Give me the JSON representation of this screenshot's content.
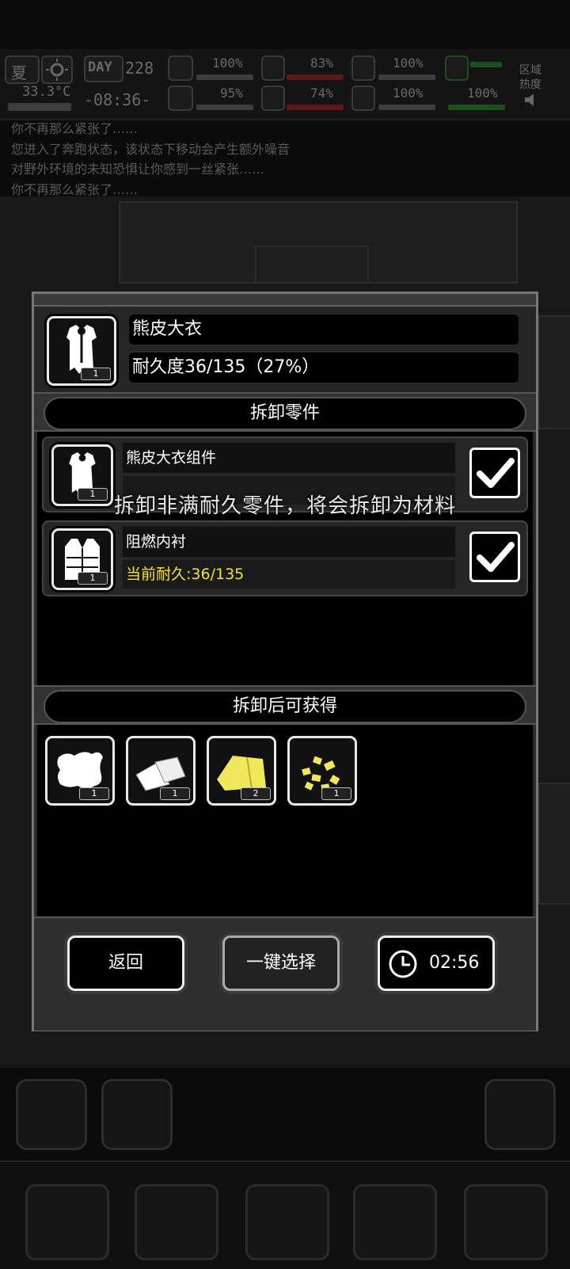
{
  "hud": {
    "season": "夏",
    "day_label": "DAY",
    "day_number": "228",
    "temperature": "33.3°C",
    "clock": "-08:36-",
    "stats": [
      {
        "icon": "medkit-icon",
        "value": "100%"
      },
      {
        "icon": "stomach-icon",
        "value": "83%"
      },
      {
        "icon": "lungs-icon",
        "value": "100%"
      },
      {
        "icon": "brain-icon",
        "value": "95%"
      },
      {
        "icon": "water-drop-icon",
        "value": "74%"
      },
      {
        "icon": "heart-icon",
        "value": "100%"
      },
      {
        "icon": "shield-icon",
        "value": "100%"
      }
    ],
    "zone_label_1": "区域",
    "zone_label_2": "热度"
  },
  "log_lines": [
    "你不再那么紧张了……",
    "您进入了奔跑状态，该状态下移动会产生额外噪音",
    "对野外环境的未知恐惧让你感到一丝紧张……",
    "你不再那么紧张了……"
  ],
  "modal": {
    "item": {
      "name": "熊皮大衣",
      "durability": "耐久度36/135（27%）",
      "quantity": "1",
      "icon": "bear-coat-icon"
    },
    "parts_header": "拆卸零件",
    "parts": [
      {
        "name": "熊皮大衣组件",
        "durability": "",
        "quantity": "1",
        "checked": true,
        "icon": "bear-coat-icon"
      },
      {
        "name": "阻燃内衬",
        "durability": "当前耐久:36/135",
        "quantity": "1",
        "checked": true,
        "icon": "vest-icon"
      }
    ],
    "results_header": "拆卸后可获得",
    "results": [
      {
        "icon": "fur-pelt-icon",
        "quantity": "1"
      },
      {
        "icon": "cloth-scraps-icon",
        "quantity": "1"
      },
      {
        "icon": "yellow-fabric-icon",
        "quantity": "2"
      },
      {
        "icon": "yellow-pieces-icon",
        "quantity": "1"
      }
    ],
    "buttons": {
      "back": "返回",
      "select_all": "一键选择",
      "timer": "02:56"
    }
  },
  "toast": "拆卸非满耐久零件，将会拆卸为材料"
}
